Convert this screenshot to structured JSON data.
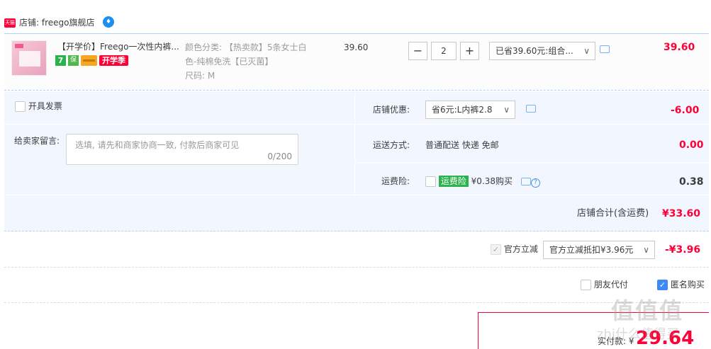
{
  "shop": {
    "badge": "天猫",
    "name": "店铺: freego旗舰店",
    "ww_icon": "wangwang-icon"
  },
  "item": {
    "title": "【开学价】Freego一次性内裤...",
    "badges": [
      "7",
      "保",
      "",
      "开学季"
    ],
    "sku_line1": "颜色分类: 【热卖款】5条女士白",
    "sku_line2": "色-纯棉免洗【已灭菌】",
    "sku_line3": "尺码: M",
    "unit_price": "39.60",
    "qty_minus": "−",
    "quantity": "2",
    "qty_plus": "+",
    "promo": "已省39.60元:组合...",
    "total": "39.60"
  },
  "order": {
    "invoice_label": "开具发票",
    "memo_label": "给卖家留言:",
    "memo_placeholder": "选填, 请先和商家协商一致, 付款后商家可见",
    "memo_count": "0/200",
    "coupon_label": "店铺优惠:",
    "coupon_value": "省6元:L内裤2.8",
    "coupon_amount": "-6.00",
    "shipping_label": "运送方式:",
    "shipping_value": "普通配送 快递 免邮",
    "shipping_amount": "0.00",
    "insurance_label": "运费险:",
    "insurance_tag": "运费险",
    "insurance_value": "¥0.38购买",
    "insurance_amount": "0.38",
    "subtotal_label": "店铺合计(含运费)",
    "subtotal_value": "¥33.60"
  },
  "discount": {
    "label": "官方立减",
    "select_value": "官方立减抵扣¥3.96元",
    "amount": "-¥3.96"
  },
  "friend": {
    "friend_pay_label": "朋友代付",
    "anon_label": "匿名购买"
  },
  "pay": {
    "label": "实付款: ¥",
    "amount": "29.64"
  },
  "watermark": {
    "line1": "值值值",
    "line2": "zhi什么值得买"
  },
  "colors": {
    "accent_red": "#ff0036",
    "blue_border": "#b2d1ff",
    "panel_bg": "#f2f7ff",
    "check_blue": "#3d8af7"
  }
}
